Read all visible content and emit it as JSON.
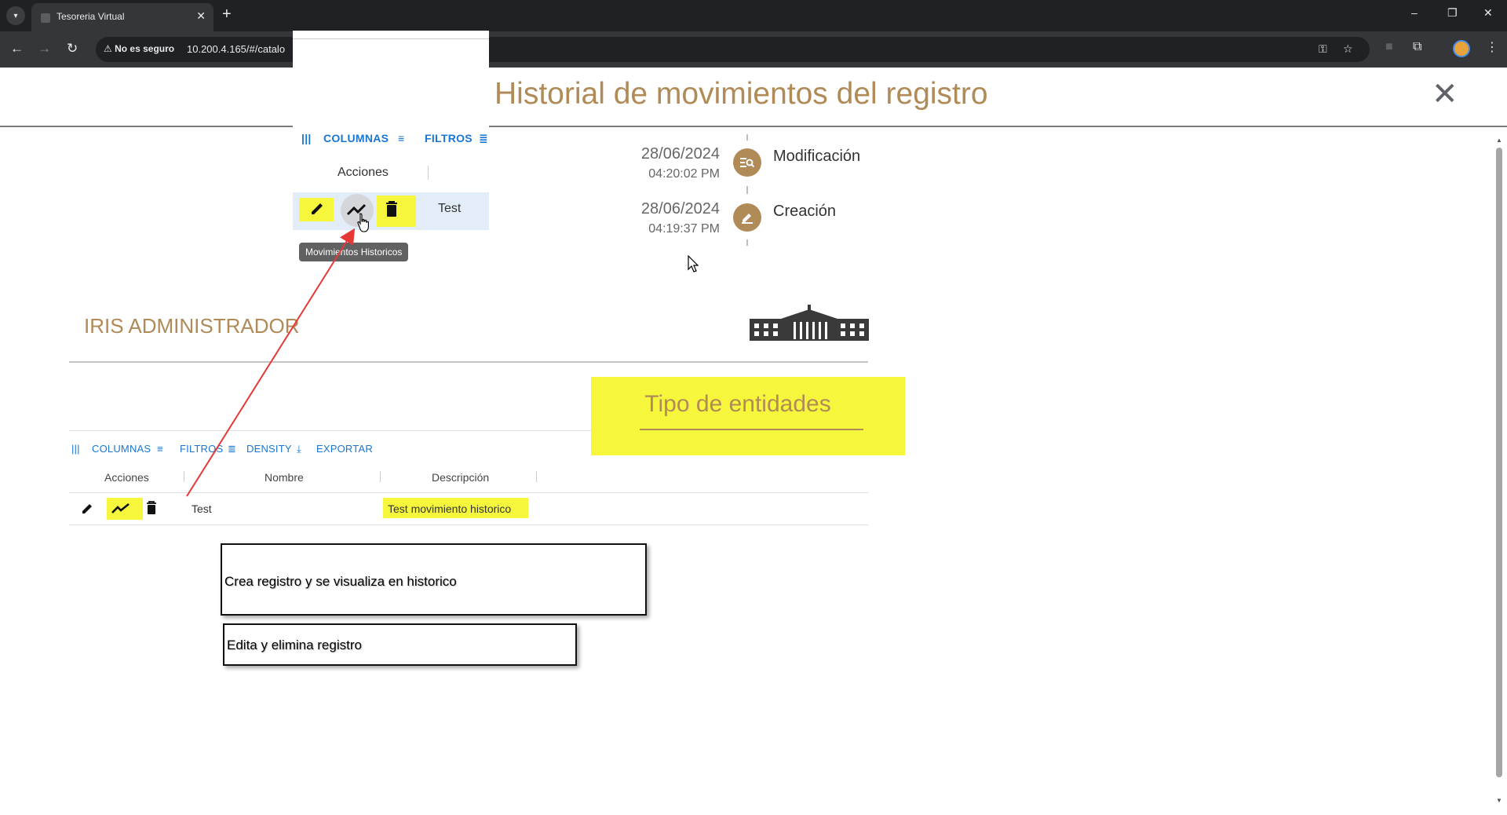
{
  "browser": {
    "tab_title": "Tesoreria Virtual",
    "new_tab": "+",
    "security_label": "No es seguro",
    "url": "10.200.4.165/#/catalo",
    "window_controls": {
      "minimize": "–",
      "restore": "❐",
      "close": "✕"
    }
  },
  "modal": {
    "title": "Historial de movimientos del registro",
    "close_label": "✕",
    "timeline": [
      {
        "date": "28/06/2024",
        "time": "04:20:02 PM",
        "label": "Modificación",
        "icon": "list-search-icon"
      },
      {
        "date": "28/06/2024",
        "time": "04:19:37 PM",
        "label": "Creación",
        "icon": "pencil-icon"
      }
    ]
  },
  "zoom_panel": {
    "columns": "COLUMNAS",
    "filters": "FILTROS",
    "acciones": "Acciones",
    "row_name": "Test",
    "tooltip": "Movimientos Historicos"
  },
  "page": {
    "org_name": "IRIS ADMINISTRADOR",
    "section_title": "Tipo de entidades",
    "toolbar": {
      "columns": "COLUMNAS",
      "filters": "FILTROS",
      "density": "DENSITY",
      "export": "EXPORTAR"
    },
    "table": {
      "headers": [
        "Acciones",
        "Nombre",
        "Descripción"
      ],
      "rows": [
        {
          "nombre": "Test",
          "descripcion": "Test movimiento historico"
        }
      ]
    }
  },
  "notes": [
    "Crea registro y se visualiza en historico",
    "Edita y elimina registro"
  ],
  "colors": {
    "accent_gold": "#b08a57",
    "highlight_yellow": "#f6f73d",
    "link_blue": "#1976d2"
  }
}
